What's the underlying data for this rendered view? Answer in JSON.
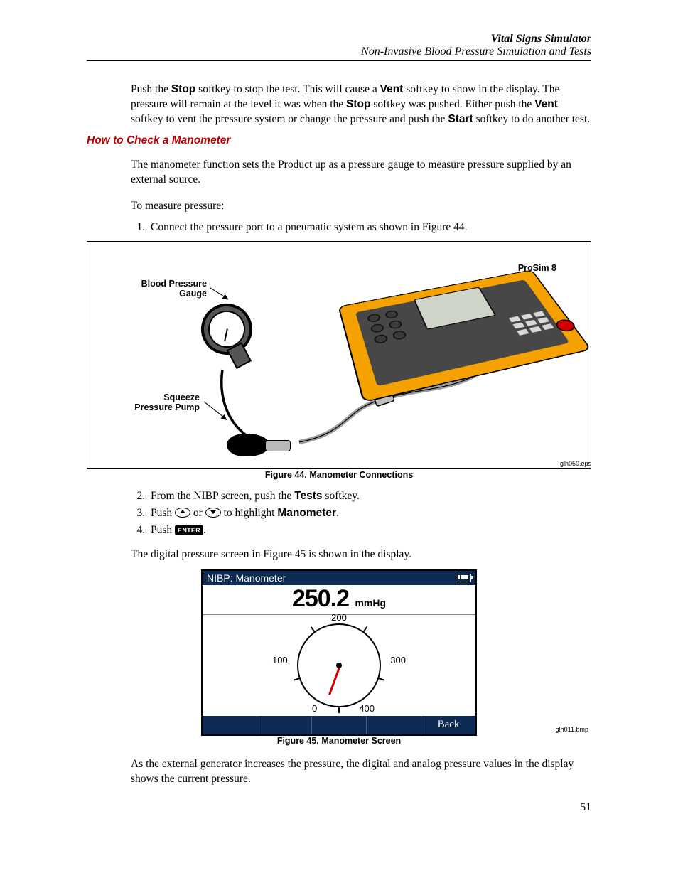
{
  "header": {
    "title": "Vital Signs Simulator",
    "subtitle": "Non-Invasive Blood Pressure Simulation and Tests"
  },
  "intro_para": {
    "p1a": "Push the ",
    "b1": "Stop",
    "p1b": " softkey to stop the test. This will cause a ",
    "b2": "Vent",
    "p1c": " softkey to show in the display. The pressure will remain at the level it was when the ",
    "b3": "Stop",
    "p1d": " softkey was pushed. Either push the ",
    "b4": "Vent",
    "p1e": " softkey to vent the pressure system or change the pressure and push the ",
    "b5": "Start",
    "p1f": " softkey to do another test."
  },
  "heading3": "How to Check a Manometer",
  "mano_text": {
    "p1": "The manometer function sets the Product up as a pressure gauge to measure pressure supplied by an external source.",
    "p2": "To measure pressure:"
  },
  "steps": {
    "s1": "Connect the pressure port to a pneumatic system as shown in Figure 44."
  },
  "fig44": {
    "label_bp": "Blood Pressure\nGauge",
    "label_pump": "Squeeze\nPressure Pump",
    "label_device": "ProSim 8",
    "caption": "Figure 44. Manometer Connections",
    "fileref": "glh050.eps"
  },
  "steps2": {
    "s2a": "From the NIBP screen, push the ",
    "s2b": "Tests",
    "s2c": " softkey.",
    "s3a": "Push ",
    "s3b": " or ",
    "s3c": " to highlight ",
    "s3d": "Manometer",
    "s3e": ".",
    "s4a": "Push ",
    "s4enter": "ENTER",
    "s4b": "."
  },
  "after_steps": "The digital pressure screen in Figure 45 is shown in the display.",
  "fig45": {
    "screen_title": "NIBP: Manometer",
    "reading_value": "250.2",
    "reading_unit": "mmHg",
    "ticks": {
      "t0": "0",
      "t100": "100",
      "t200": "200",
      "t300": "300",
      "t400": "400"
    },
    "softkeys": [
      "",
      "",
      "",
      "",
      "Back"
    ],
    "caption": "Figure 45. Manometer Screen",
    "fileref": "glh011.bmp"
  },
  "closing": "As the external generator increases the pressure, the digital and analog pressure values in the display shows the current pressure.",
  "page_number": "51"
}
